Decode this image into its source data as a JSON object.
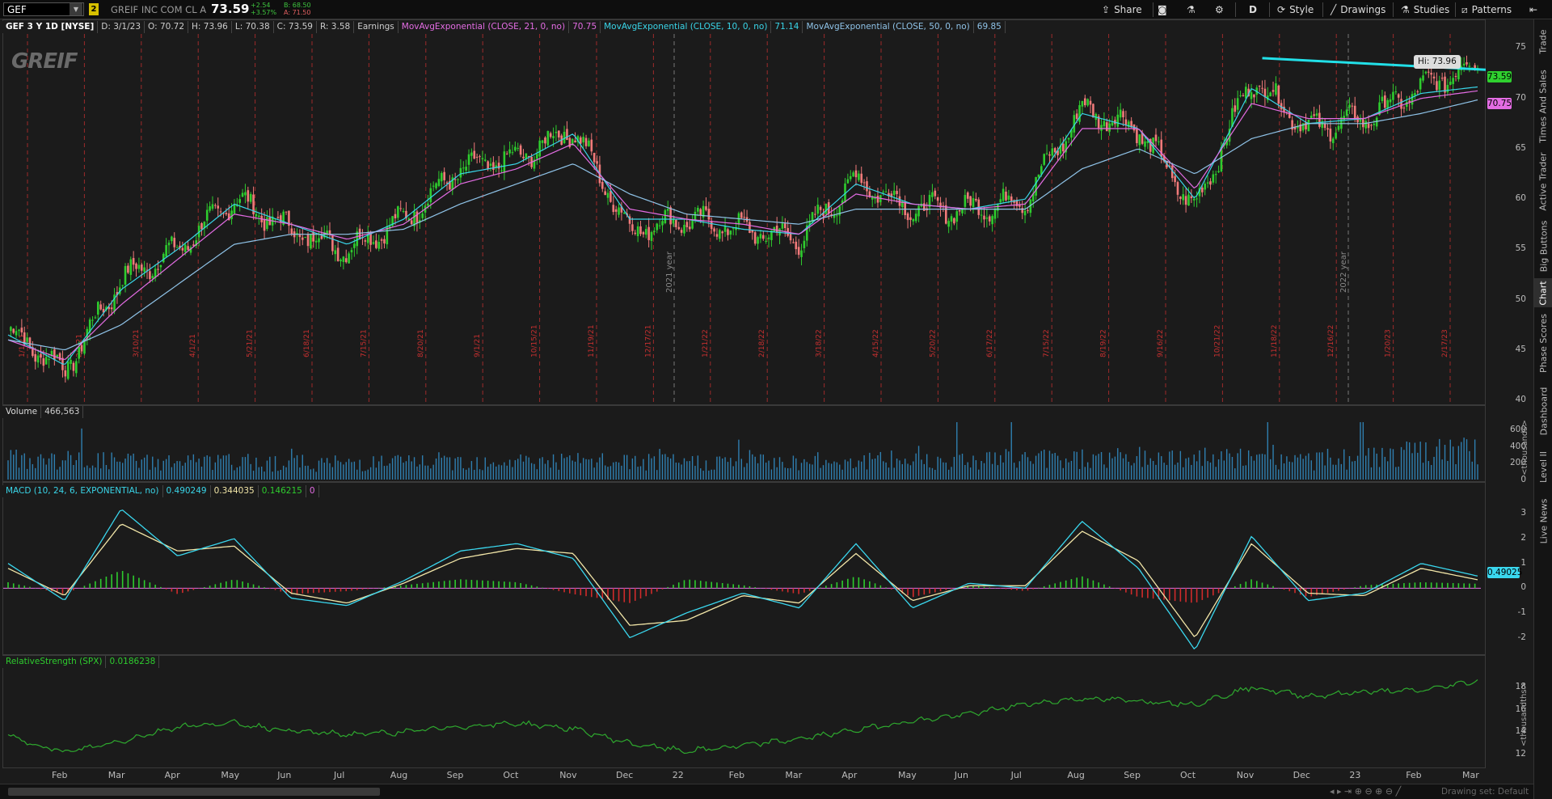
{
  "toolbar": {
    "symbol": "GEF",
    "link_badge": "2",
    "description": "GREIF INC COM CL A",
    "last": "73.59",
    "change": "+2.54",
    "change_pct": "+3.57%",
    "bid": "B: 68.50",
    "ask": "A: 71.50",
    "share": "Share",
    "aggregation": "D",
    "style": "Style",
    "drawings": "Drawings",
    "studies": "Studies",
    "patterns": "Patterns"
  },
  "price_header": {
    "title": "GEF 3 Y 1D [NYSE]",
    "date": "D: 3/1/23",
    "open": "O: 70.72",
    "high": "H: 73.96",
    "low": "L: 70.38",
    "close": "C: 73.59",
    "range": "R: 3.58",
    "earnings": "Earnings",
    "ema21_label": "MovAvgExponential (CLOSE, 21, 0, no)",
    "ema21_value": "70.75",
    "ema10_label": "MovAvgExponential (CLOSE, 10, 0, no)",
    "ema10_value": "71.14",
    "ema50_label": "MovAvgExponential (CLOSE, 50, 0, no)",
    "ema50_value": "69.85"
  },
  "logo_text": "GREIF",
  "hi_label": "Hi: 73.96",
  "price_tags": {
    "last": "73.59",
    "ema21": "70.75"
  },
  "price_axis": [
    "75",
    "70",
    "65",
    "60",
    "55",
    "50",
    "45",
    "40"
  ],
  "volume_header": {
    "label": "Volume",
    "value": "466,563"
  },
  "volume_axis": [
    "600",
    "400",
    "200",
    "0"
  ],
  "volume_unit": "<thousands>",
  "macd_header": {
    "label": "MACD (10, 24, 6, EXPONENTIAL, no)",
    "value": "0.490249",
    "avg": "0.344035",
    "diff": "0.146215",
    "zero": "0"
  },
  "macd_axis": [
    "3",
    "2",
    "1",
    "0",
    "-1",
    "-2"
  ],
  "macd_tag": "0.49025",
  "rs_header": {
    "label": "RelativeStrength (SPX)",
    "value": "0.0186238"
  },
  "rs_axis": [
    "18",
    "16",
    "14",
    "12"
  ],
  "rs_unit": "<thousandths>",
  "months": [
    "Feb",
    "Mar",
    "Apr",
    "May",
    "Jun",
    "Jul",
    "Aug",
    "Sep",
    "Oct",
    "Nov",
    "Dec",
    "22",
    "Feb",
    "Mar",
    "Apr",
    "May",
    "Jun",
    "Jul",
    "Aug",
    "Sep",
    "Oct",
    "Nov",
    "Dec",
    "23",
    "Feb",
    "Mar"
  ],
  "earnings_dates": [
    "1/1/21",
    "2/1/21",
    "3/10/21",
    "4/1/21",
    "5/21/21",
    "6/18/21",
    "7/15/21",
    "8/20/21",
    "9/1/21",
    "10/15/21",
    "11/19/21",
    "12/17/21",
    "1/21/22",
    "2/18/22",
    "3/18/22",
    "4/15/22",
    "5/20/22",
    "6/17/22",
    "7/15/22",
    "8/19/22",
    "9/16/22",
    "10/21/22",
    "11/18/22",
    "12/16/22",
    "1/20/23",
    "2/17/23"
  ],
  "year_markers": [
    "2021 year",
    "2022 year"
  ],
  "right_tabs": [
    "Trade",
    "Times And Sales",
    "Active Trader",
    "Big Buttons",
    "Chart",
    "Phase Scores",
    "Dashboard",
    "Level II",
    "Live News"
  ],
  "status_text": "Drawing set: Default",
  "colors": {
    "up": "#2ecc2e",
    "down": "#f07a7a",
    "ema10": "#39d5e8",
    "ema21": "#e36ce3",
    "ema50": "#8fc3e8",
    "trendline": "#22e0e8",
    "macd": "#3ad7ee",
    "macd_avg": "#f2e6a8",
    "rs": "#2ea82e",
    "earnings_line": "#c83030"
  },
  "chart_data": [
    {
      "type": "candlestick",
      "title": "GEF 3 Y 1D [NYSE]",
      "ylim": [
        40,
        76
      ],
      "x": [
        "Jan 21",
        "Feb 21",
        "Mar 21",
        "Apr 21",
        "May 21",
        "Jun 21",
        "Jul 21",
        "Aug 21",
        "Sep 21",
        "Oct 21",
        "Nov 21",
        "Dec 21",
        "Jan 22",
        "Feb 22",
        "Mar 22",
        "Apr 22",
        "May 22",
        "Jun 22",
        "Jul 22",
        "Aug 22",
        "Sep 22",
        "Oct 22",
        "Nov 22",
        "Dec 22",
        "Jan 23",
        "Feb 23",
        "Mar 23"
      ],
      "series": [
        {
          "name": "Close",
          "values": [
            47,
            43,
            52,
            55,
            60,
            57,
            55,
            58,
            63,
            64,
            67,
            57,
            58,
            57,
            56,
            62,
            59,
            59,
            60,
            69,
            67,
            59,
            72,
            67,
            68,
            71,
            73.59
          ]
        },
        {
          "name": "MovAvgExponential (CLOSE, 10, 0, no)",
          "values": [
            46.5,
            43.5,
            51,
            55,
            59.5,
            57.5,
            55.5,
            58,
            62.5,
            63.5,
            66.5,
            58,
            58,
            57,
            56.5,
            61.5,
            59.5,
            59,
            60,
            68.5,
            67,
            60,
            71,
            67.5,
            68,
            70.5,
            71.14
          ]
        },
        {
          "name": "MovAvgExponential (CLOSE, 21, 0, no)",
          "values": [
            46,
            44,
            49.5,
            54,
            58.5,
            57.5,
            56,
            57.5,
            61.5,
            63,
            65.5,
            59,
            58,
            57.5,
            56.5,
            60.5,
            59.5,
            59,
            59.5,
            67,
            67,
            61,
            69.5,
            68,
            68,
            70,
            70.75
          ]
        },
        {
          "name": "MovAvgExponential (CLOSE, 50, 0, no)",
          "values": [
            46,
            45,
            47.5,
            51.5,
            55.5,
            56.5,
            56.5,
            57,
            59.5,
            61.5,
            63.5,
            60.5,
            58.5,
            58,
            57.5,
            59,
            59,
            59,
            59,
            63,
            65,
            62.5,
            66,
            67.5,
            67.5,
            68.5,
            69.85
          ]
        }
      ]
    },
    {
      "type": "bar",
      "title": "Volume",
      "ylim": [
        0,
        700
      ],
      "x": [
        "Jan 21",
        "Apr 21",
        "Jul 21",
        "Oct 21",
        "Jan 22",
        "Apr 22",
        "Jul 22",
        "Oct 22",
        "Jan 23",
        "Mar 23"
      ],
      "values": [
        320,
        280,
        260,
        300,
        270,
        290,
        330,
        350,
        310,
        466.563
      ]
    },
    {
      "type": "line",
      "title": "MACD (10, 24, 6, EXPONENTIAL, no)",
      "ylim": [
        -2.6,
        3.6
      ],
      "x": [
        "Jan 21",
        "Feb 21",
        "Mar 21",
        "Apr 21",
        "May 21",
        "Jun 21",
        "Jul 21",
        "Aug 21",
        "Sep 21",
        "Oct 21",
        "Nov 21",
        "Dec 21",
        "Jan 22",
        "Feb 22",
        "Mar 22",
        "Apr 22",
        "May 22",
        "Jun 22",
        "Jul 22",
        "Aug 22",
        "Sep 22",
        "Oct 22",
        "Nov 22",
        "Dec 22",
        "Jan 23",
        "Feb 23",
        "Mar 23"
      ],
      "series": [
        {
          "name": "MACD",
          "values": [
            1.0,
            -0.5,
            3.2,
            1.3,
            2.0,
            -0.4,
            -0.7,
            0.3,
            1.5,
            1.8,
            1.2,
            -2.0,
            -1.0,
            -0.2,
            -0.8,
            1.8,
            -0.8,
            0.2,
            0.0,
            2.7,
            0.8,
            -2.5,
            2.1,
            -0.5,
            -0.2,
            1.0,
            0.49
          ]
        },
        {
          "name": "MACD Avg",
          "values": [
            0.8,
            -0.3,
            2.6,
            1.5,
            1.7,
            -0.2,
            -0.6,
            0.2,
            1.2,
            1.6,
            1.4,
            -1.5,
            -1.3,
            -0.3,
            -0.6,
            1.4,
            -0.5,
            0.1,
            0.1,
            2.3,
            1.1,
            -2.0,
            1.8,
            -0.2,
            -0.3,
            0.8,
            0.34
          ]
        }
      ]
    },
    {
      "type": "line",
      "title": "RelativeStrength (SPX)",
      "ylim": [
        11,
        19.5
      ],
      "x": [
        "Jan 21",
        "Feb 21",
        "Mar 21",
        "Apr 21",
        "May 21",
        "Jun 21",
        "Jul 21",
        "Aug 21",
        "Sep 21",
        "Oct 21",
        "Nov 21",
        "Dec 21",
        "Jan 22",
        "Feb 22",
        "Mar 22",
        "Apr 22",
        "May 22",
        "Jun 22",
        "Jul 22",
        "Aug 22",
        "Sep 22",
        "Oct 22",
        "Nov 22",
        "Dec 22",
        "Jan 23",
        "Feb 23",
        "Mar 23"
      ],
      "series": [
        {
          "name": "RelativeStrength (SPX)",
          "values": [
            13.6,
            12.2,
            13.2,
            14.5,
            14.8,
            14.1,
            13.8,
            14.0,
            14.5,
            14.8,
            14.3,
            13.0,
            12.3,
            12.8,
            13.4,
            14.2,
            15.0,
            15.6,
            16.5,
            17.0,
            16.8,
            16.5,
            18.0,
            17.2,
            17.6,
            17.7,
            18.6
          ]
        }
      ]
    }
  ]
}
